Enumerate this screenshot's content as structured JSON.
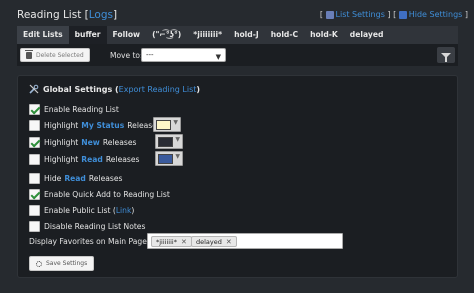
{
  "header": {
    "title": "Reading List",
    "title_bracket_open": "[",
    "logs_link": "Logs",
    "title_bracket_close": "]",
    "list_settings": "List Settings",
    "hide_settings": "Hide Settings",
    "rss_icon": "rss-icon"
  },
  "tabs": [
    {
      "label": "Edit Lists"
    },
    {
      "label": "buffer"
    },
    {
      "label": "Follow"
    },
    {
      "label": "(\"⌐͡°͜ʖ͡°)"
    },
    {
      "label": "*jiiiiiii*"
    },
    {
      "label": "hold-J"
    },
    {
      "label": "hold-C"
    },
    {
      "label": "hold-K"
    },
    {
      "label": "delayed"
    }
  ],
  "toolbar": {
    "delete_selected": "Delete Selected",
    "move_to_label": "Move to:",
    "move_to_value": "---"
  },
  "settings": {
    "title": "Global Settings",
    "export_open": "(",
    "export_link": "Export Reading List",
    "export_close": ")",
    "enable_reading_list": {
      "label": "Enable Reading List",
      "checked": true
    },
    "highlight_my_status": {
      "pre": "Highlight",
      "keyword": "My Status",
      "post": "Release",
      "checked": false,
      "color": "#fdf6c8"
    },
    "highlight_new": {
      "pre": "Highlight",
      "keyword": "New",
      "post": "Releases",
      "checked": true,
      "color": "#2a2c34"
    },
    "highlight_read": {
      "pre": "Highlight",
      "keyword": "Read",
      "post": "Releases",
      "checked": false,
      "color": "#3a5a9c"
    },
    "hide_read": {
      "pre": "Hide",
      "keyword": "Read",
      "post": "Releases",
      "checked": false
    },
    "quick_add": {
      "label": "Enable Quick Add to Reading List",
      "checked": true
    },
    "public_list": {
      "pre": "Enable Public List (",
      "link": "Link",
      "post": ")",
      "checked": false
    },
    "disable_notes": {
      "label": "Disable Reading List Notes",
      "checked": false
    },
    "favorites_label": "Display Favorites on Main Page:",
    "favorites": [
      "*jiiiiiii*",
      "delayed"
    ],
    "save_label": "Save Settings"
  },
  "colors": {
    "background": "#262a2f",
    "panel": "#1b1e22",
    "link": "#3f8ed8"
  }
}
